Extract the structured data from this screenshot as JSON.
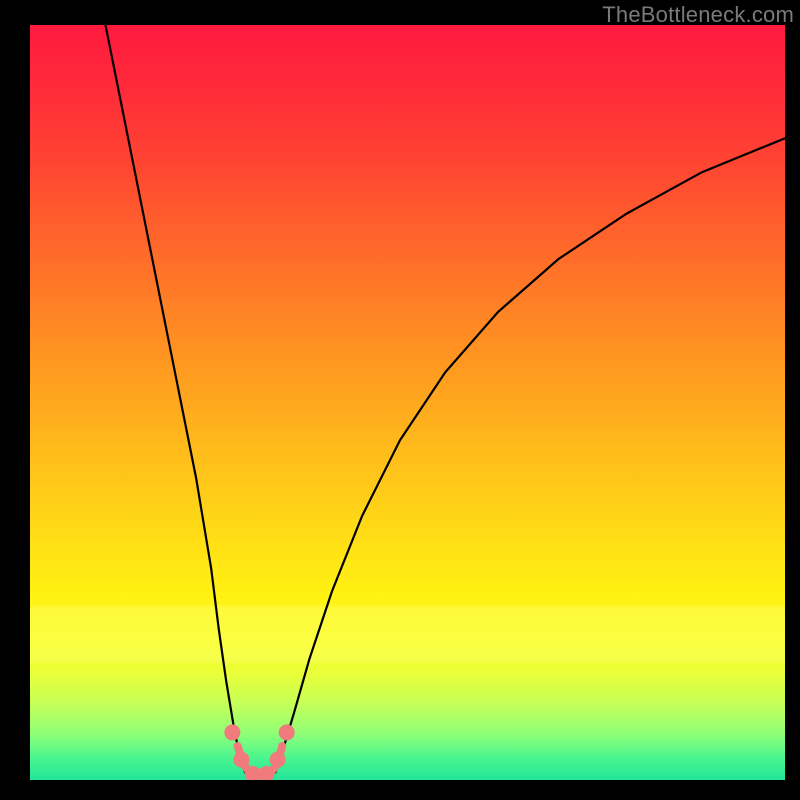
{
  "watermark": "TheBottleneck.com",
  "chart_data": {
    "type": "line",
    "title": "",
    "xlabel": "",
    "ylabel": "",
    "xlim": [
      0,
      100
    ],
    "ylim": [
      0,
      100
    ],
    "series": [
      {
        "name": "left-curve",
        "x": [
          10,
          12,
          14,
          16,
          18,
          20,
          22,
          24,
          25,
          26,
          27,
          27.8,
          28.5
        ],
        "y": [
          100,
          90,
          80,
          70,
          60,
          50,
          40,
          28,
          20,
          13,
          7,
          3,
          1
        ]
      },
      {
        "name": "right-curve",
        "x": [
          32.5,
          33.5,
          35,
          37,
          40,
          44,
          49,
          55,
          62,
          70,
          79,
          89,
          100
        ],
        "y": [
          1,
          4,
          9,
          16,
          25,
          35,
          45,
          54,
          62,
          69,
          75,
          80.5,
          85
        ]
      }
    ],
    "markers": {
      "name": "valley-markers",
      "color": "#f07a7c",
      "line_width": 8,
      "point_radius": 8,
      "line": {
        "x": [
          27.5,
          28.2,
          29.0,
          30.0,
          31.0,
          32.0,
          32.8,
          33.4
        ],
        "y": [
          4.5,
          2.3,
          1.1,
          0.6,
          0.6,
          1.1,
          2.3,
          4.5
        ]
      },
      "points": [
        {
          "x": 26.8,
          "y": 6.3
        },
        {
          "x": 28.0,
          "y": 2.7
        },
        {
          "x": 29.5,
          "y": 0.8
        },
        {
          "x": 31.3,
          "y": 0.8
        },
        {
          "x": 32.8,
          "y": 2.7
        },
        {
          "x": 34.0,
          "y": 6.3
        }
      ]
    }
  }
}
